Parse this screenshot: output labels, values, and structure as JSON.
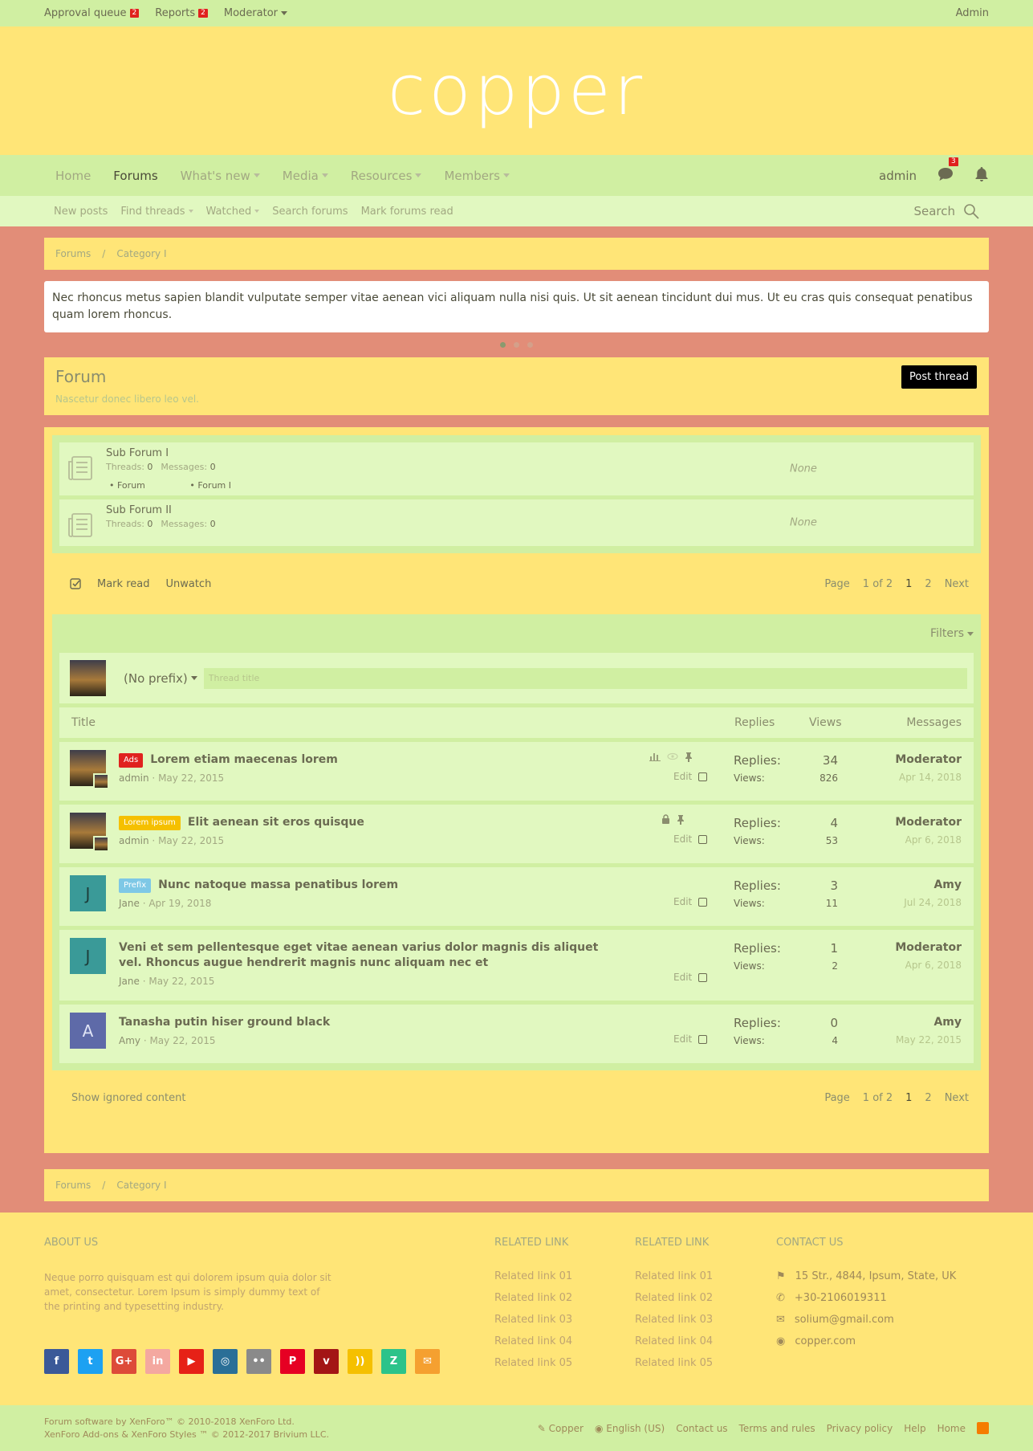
{
  "topbar": {
    "items": [
      {
        "label": "Approval queue",
        "badge": "2"
      },
      {
        "label": "Reports",
        "badge": "2"
      },
      {
        "label": "Moderator"
      }
    ],
    "account": "Admin"
  },
  "logo": "copper",
  "nav": {
    "tabs": [
      "Home",
      "Forums",
      "What's new",
      "Media",
      "Resources",
      "Members"
    ],
    "active": "Forums",
    "user": "admin",
    "conv_badge": "3"
  },
  "subnav": {
    "items": [
      "New posts",
      "Find threads",
      "Watched",
      "Search forums",
      "Mark forums read"
    ],
    "search": "Search"
  },
  "breadcrumb": [
    "Forums",
    "Category I"
  ],
  "notice": "Nec rhoncus metus sapien blandit vulputate semper vitae aenean vici aliquam nulla nisi quis. Ut sit aenean tincidunt dui mus. Ut eu cras quis consequat penatibus quam lorem rhoncus.",
  "forum": {
    "title": "Forum",
    "description": "Nascetur donec libero leo vel.",
    "post_button": "Post thread"
  },
  "subforums": [
    {
      "title": "Sub Forum I",
      "threads_label": "Threads:",
      "threads": "0",
      "messages_label": "Messages:",
      "messages": "0",
      "children": [
        "Forum",
        "Forum I"
      ],
      "latest": "None"
    },
    {
      "title": "Sub Forum II",
      "threads_label": "Threads:",
      "threads": "0",
      "messages_label": "Messages:",
      "messages": "0",
      "latest": "None"
    }
  ],
  "actions": {
    "mark_read": "Mark read",
    "unwatch": "Unwatch",
    "page_label": "Page",
    "page_of": "1 of 2",
    "page1": "1",
    "page2": "2",
    "next": "Next"
  },
  "filters": "Filters",
  "quick_thread": {
    "prefix": "(No prefix)",
    "placeholder": "Thread title"
  },
  "columns": {
    "title": "Title",
    "replies": "Replies",
    "views": "Views",
    "messages": "Messages"
  },
  "threads": [
    {
      "label": "Ads",
      "label_color": "#e0221e",
      "title": "Lorem etiam maecenas lorem",
      "author": "admin",
      "date": "May 22, 2015",
      "replies": "34",
      "views": "826",
      "last_user": "Moderator",
      "last_date": "Apr 14, 2018",
      "edit": "Edit"
    },
    {
      "label": "Lorem ipsum",
      "label_color": "#f5c000",
      "title": "Elit aenean sit eros quisque",
      "author": "admin",
      "date": "May 22, 2015",
      "replies": "4",
      "views": "53",
      "last_user": "Moderator",
      "last_date": "Apr 6, 2018",
      "edit": "Edit"
    },
    {
      "label": "Prefix",
      "label_color": "#7ec8e6",
      "title": "Nunc natoque massa penatibus lorem",
      "author": "Jane",
      "date": "Apr 19, 2018",
      "replies": "3",
      "views": "11",
      "last_user": "Amy",
      "last_date": "Jul 24, 2018",
      "edit": "Edit",
      "letter": "J"
    },
    {
      "title": "Veni et sem pellentesque eget vitae aenean varius dolor magnis dis aliquet vel. Rhoncus augue hendrerit magnis nunc aliquam nec et",
      "author": "Jane",
      "date": "May 22, 2015",
      "replies": "1",
      "views": "2",
      "last_user": "Moderator",
      "last_date": "Apr 6, 2018",
      "edit": "Edit",
      "letter": "J"
    },
    {
      "title": "Tanasha putin hiser ground black",
      "author": "Amy",
      "date": "May 22, 2015",
      "replies": "0",
      "views": "4",
      "last_user": "Amy",
      "last_date": "May 22, 2015",
      "edit": "Edit",
      "letter": "A"
    }
  ],
  "row_labels": {
    "replies": "Replies:",
    "views": "Views:"
  },
  "show_ignored": "Show ignored content",
  "footer": {
    "about_title": "ABOUT US",
    "about_text": "Neque porro quisquam est qui dolorem ipsum quia dolor sit amet, consectetur. Lorem Ipsum is simply dummy text of the printing and typesetting industry.",
    "related_title": "RELATED LINK",
    "related_links": [
      "Related link 01",
      "Related link 02",
      "Related link 03",
      "Related link 04",
      "Related link 05"
    ],
    "contact_title": "CONTACT US",
    "address": "15 Str., 4844, Ipsum, State, UK",
    "phone": "+30-2106019311",
    "email": "solium@gmail.com",
    "website": "copper.com"
  },
  "socials": [
    {
      "icon": "facebook-icon",
      "glyph": "f",
      "color": "#3b5998"
    },
    {
      "icon": "twitter-icon",
      "glyph": "t",
      "color": "#1da1f2"
    },
    {
      "icon": "google-plus-icon",
      "glyph": "G+",
      "color": "#dd4b39"
    },
    {
      "icon": "linkedin-icon",
      "glyph": "in",
      "color": "#f4a8a0"
    },
    {
      "icon": "youtube-icon",
      "glyph": "▶",
      "color": "#e62117"
    },
    {
      "icon": "dribbble-icon",
      "glyph": "◎",
      "color": "#2a6f97"
    },
    {
      "icon": "flickr-icon",
      "glyph": "••",
      "color": "#8a8a8a"
    },
    {
      "icon": "pinterest-icon",
      "glyph": "P",
      "color": "#e60023"
    },
    {
      "icon": "vimeo-icon",
      "glyph": "v",
      "color": "#a31515"
    },
    {
      "icon": "rss-icon",
      "glyph": "))",
      "color": "#f5c000"
    },
    {
      "icon": "deviantart-icon",
      "glyph": "Z",
      "color": "#2cc38a"
    },
    {
      "icon": "email-icon",
      "glyph": "✉",
      "color": "#f5a030"
    }
  ],
  "footbar": {
    "line1": "Forum software by XenForo™ © 2010-2018 XenForo Ltd.",
    "line2": "XenForo Add-ons & XenForo Styles ™ © 2012-2017 Brivium LLC.",
    "links": [
      "Copper",
      "English (US)",
      "Contact us",
      "Terms and rules",
      "Privacy policy",
      "Help",
      "Home"
    ]
  }
}
